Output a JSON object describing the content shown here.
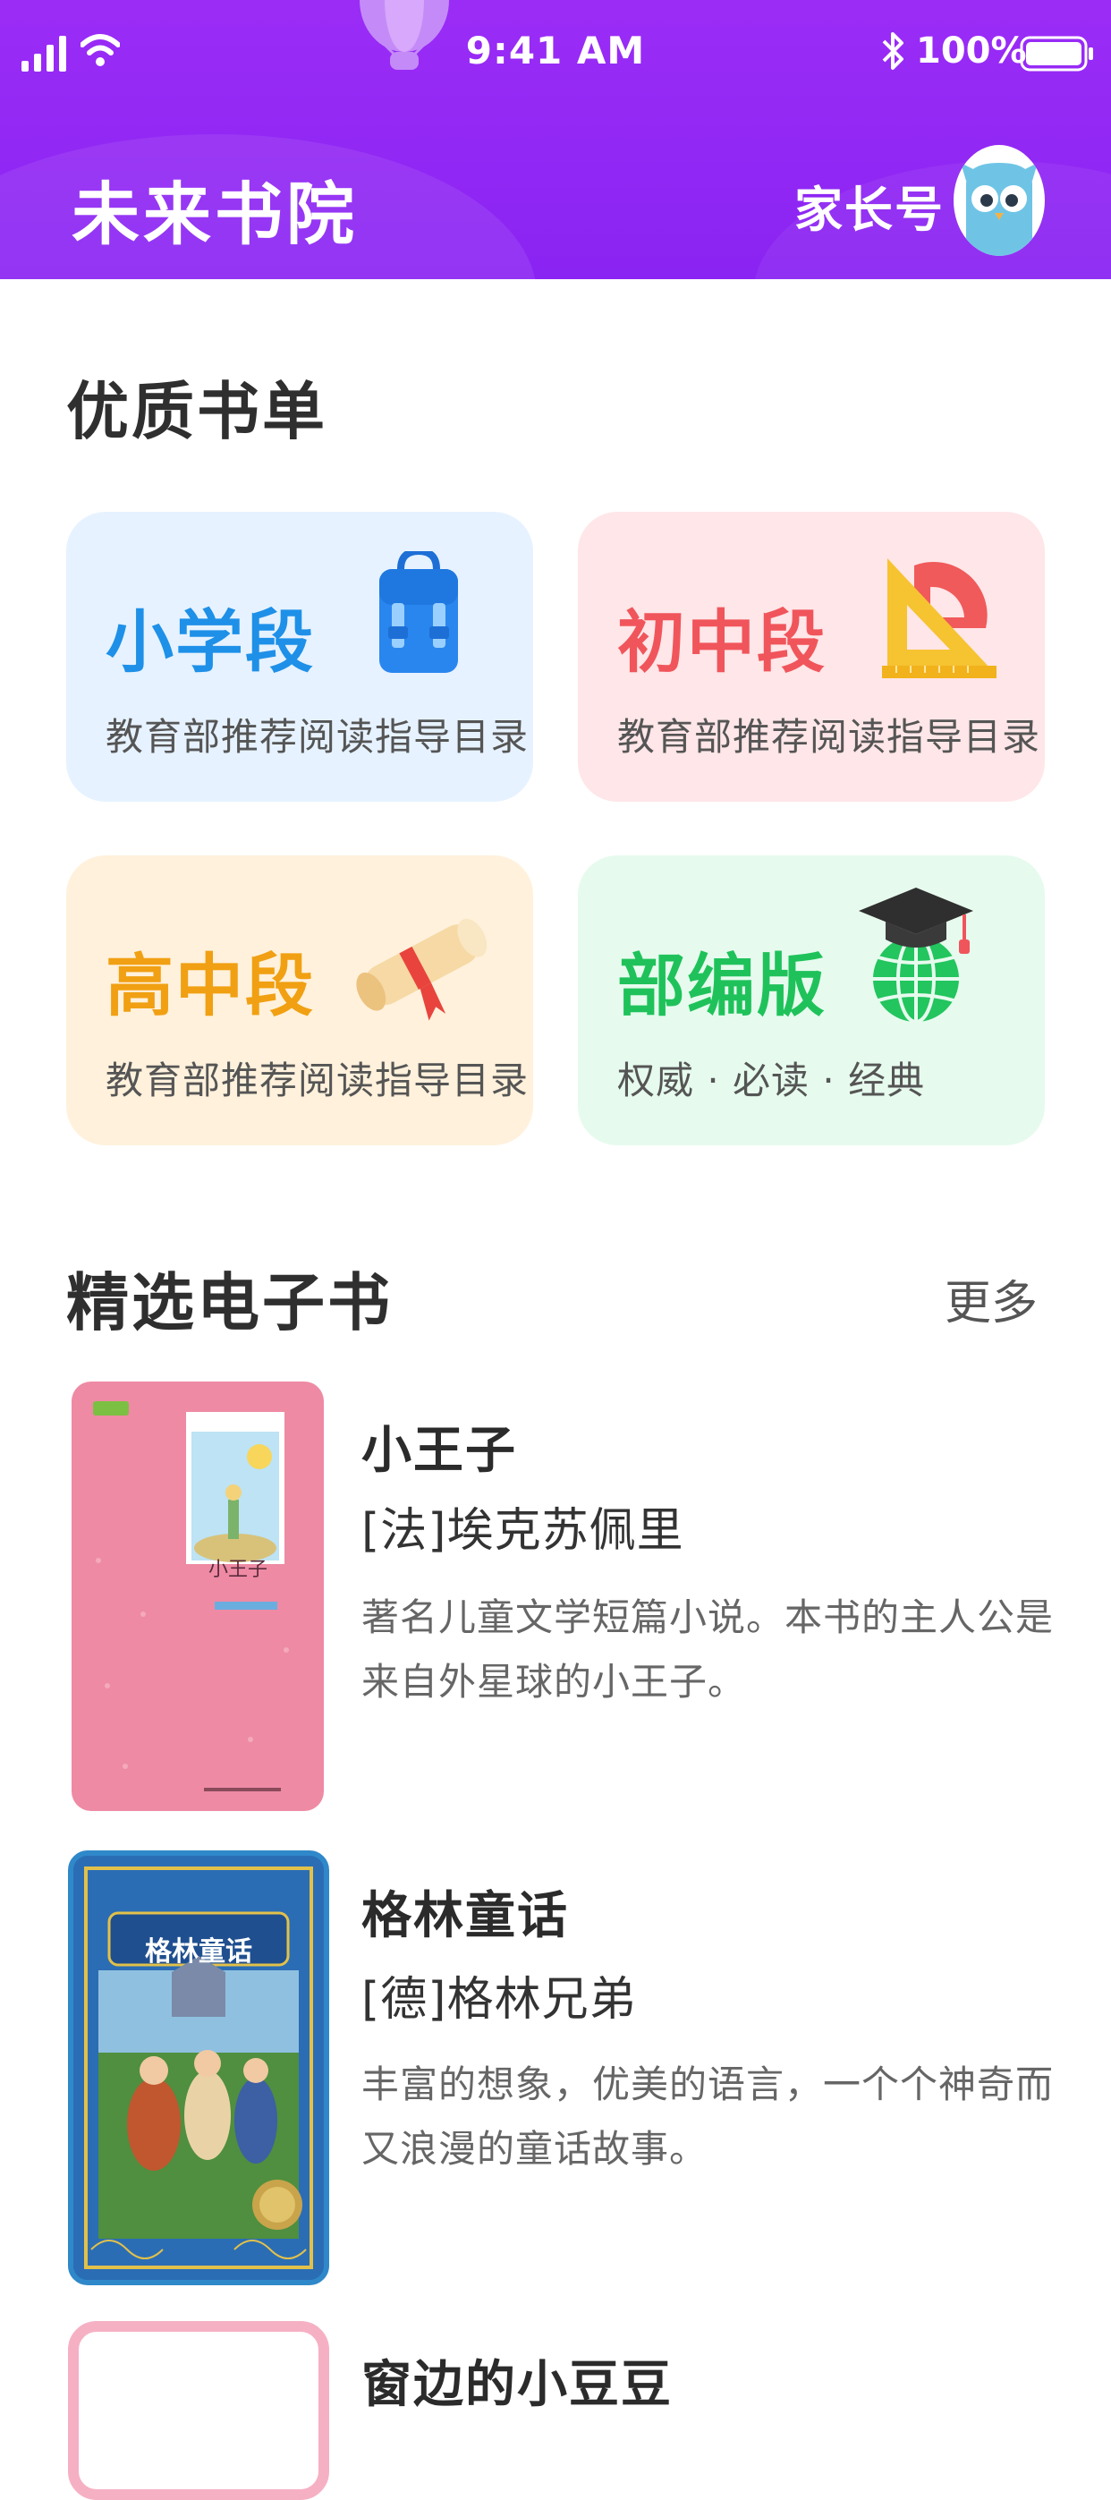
{
  "status_bar": {
    "time": "9:41 AM",
    "battery": "100%"
  },
  "header": {
    "app_title": "未来书院",
    "parent_label": "家长号"
  },
  "sections": {
    "booklist_title": "优质书单",
    "ebooks_title": "精选电子书",
    "more_label": "更多"
  },
  "categories": [
    {
      "title": "小学段",
      "subtitle": "教育部推荐阅读指导目录",
      "color": "#1e90e8",
      "bg": "#e6f2ff",
      "icon": "backpack-icon"
    },
    {
      "title": "初中段",
      "subtitle": "教育部推荐阅读指导目录",
      "color": "#f0555b",
      "bg": "#ffe6e8",
      "icon": "ruler-protractor-icon"
    },
    {
      "title": "高中段",
      "subtitle": "教育部推荐阅读指导目录",
      "color": "#f0a012",
      "bg": "#fff1dc",
      "icon": "diploma-scroll-icon"
    },
    {
      "title": "部编版",
      "subtitle": "权威 · 必读 · 经典",
      "color": "#1fc25a",
      "bg": "#e6fbee",
      "icon": "graduation-globe-icon"
    }
  ],
  "books": [
    {
      "title": "小王子",
      "author": "[法]埃克苏佩里",
      "desc": "著名儿童文学短篇小说。本书的主人公是来自外星球的小王子。",
      "cover_title": "小王子"
    },
    {
      "title": "格林童话",
      "author": "[德]格林兄弟",
      "desc": "丰富的想象，优美的语言，一个个神奇而又浪漫的童话故事。",
      "cover_title": "格林童话"
    },
    {
      "title": "窗边的小豆豆",
      "author": "",
      "desc": "",
      "cover_title": ""
    }
  ]
}
